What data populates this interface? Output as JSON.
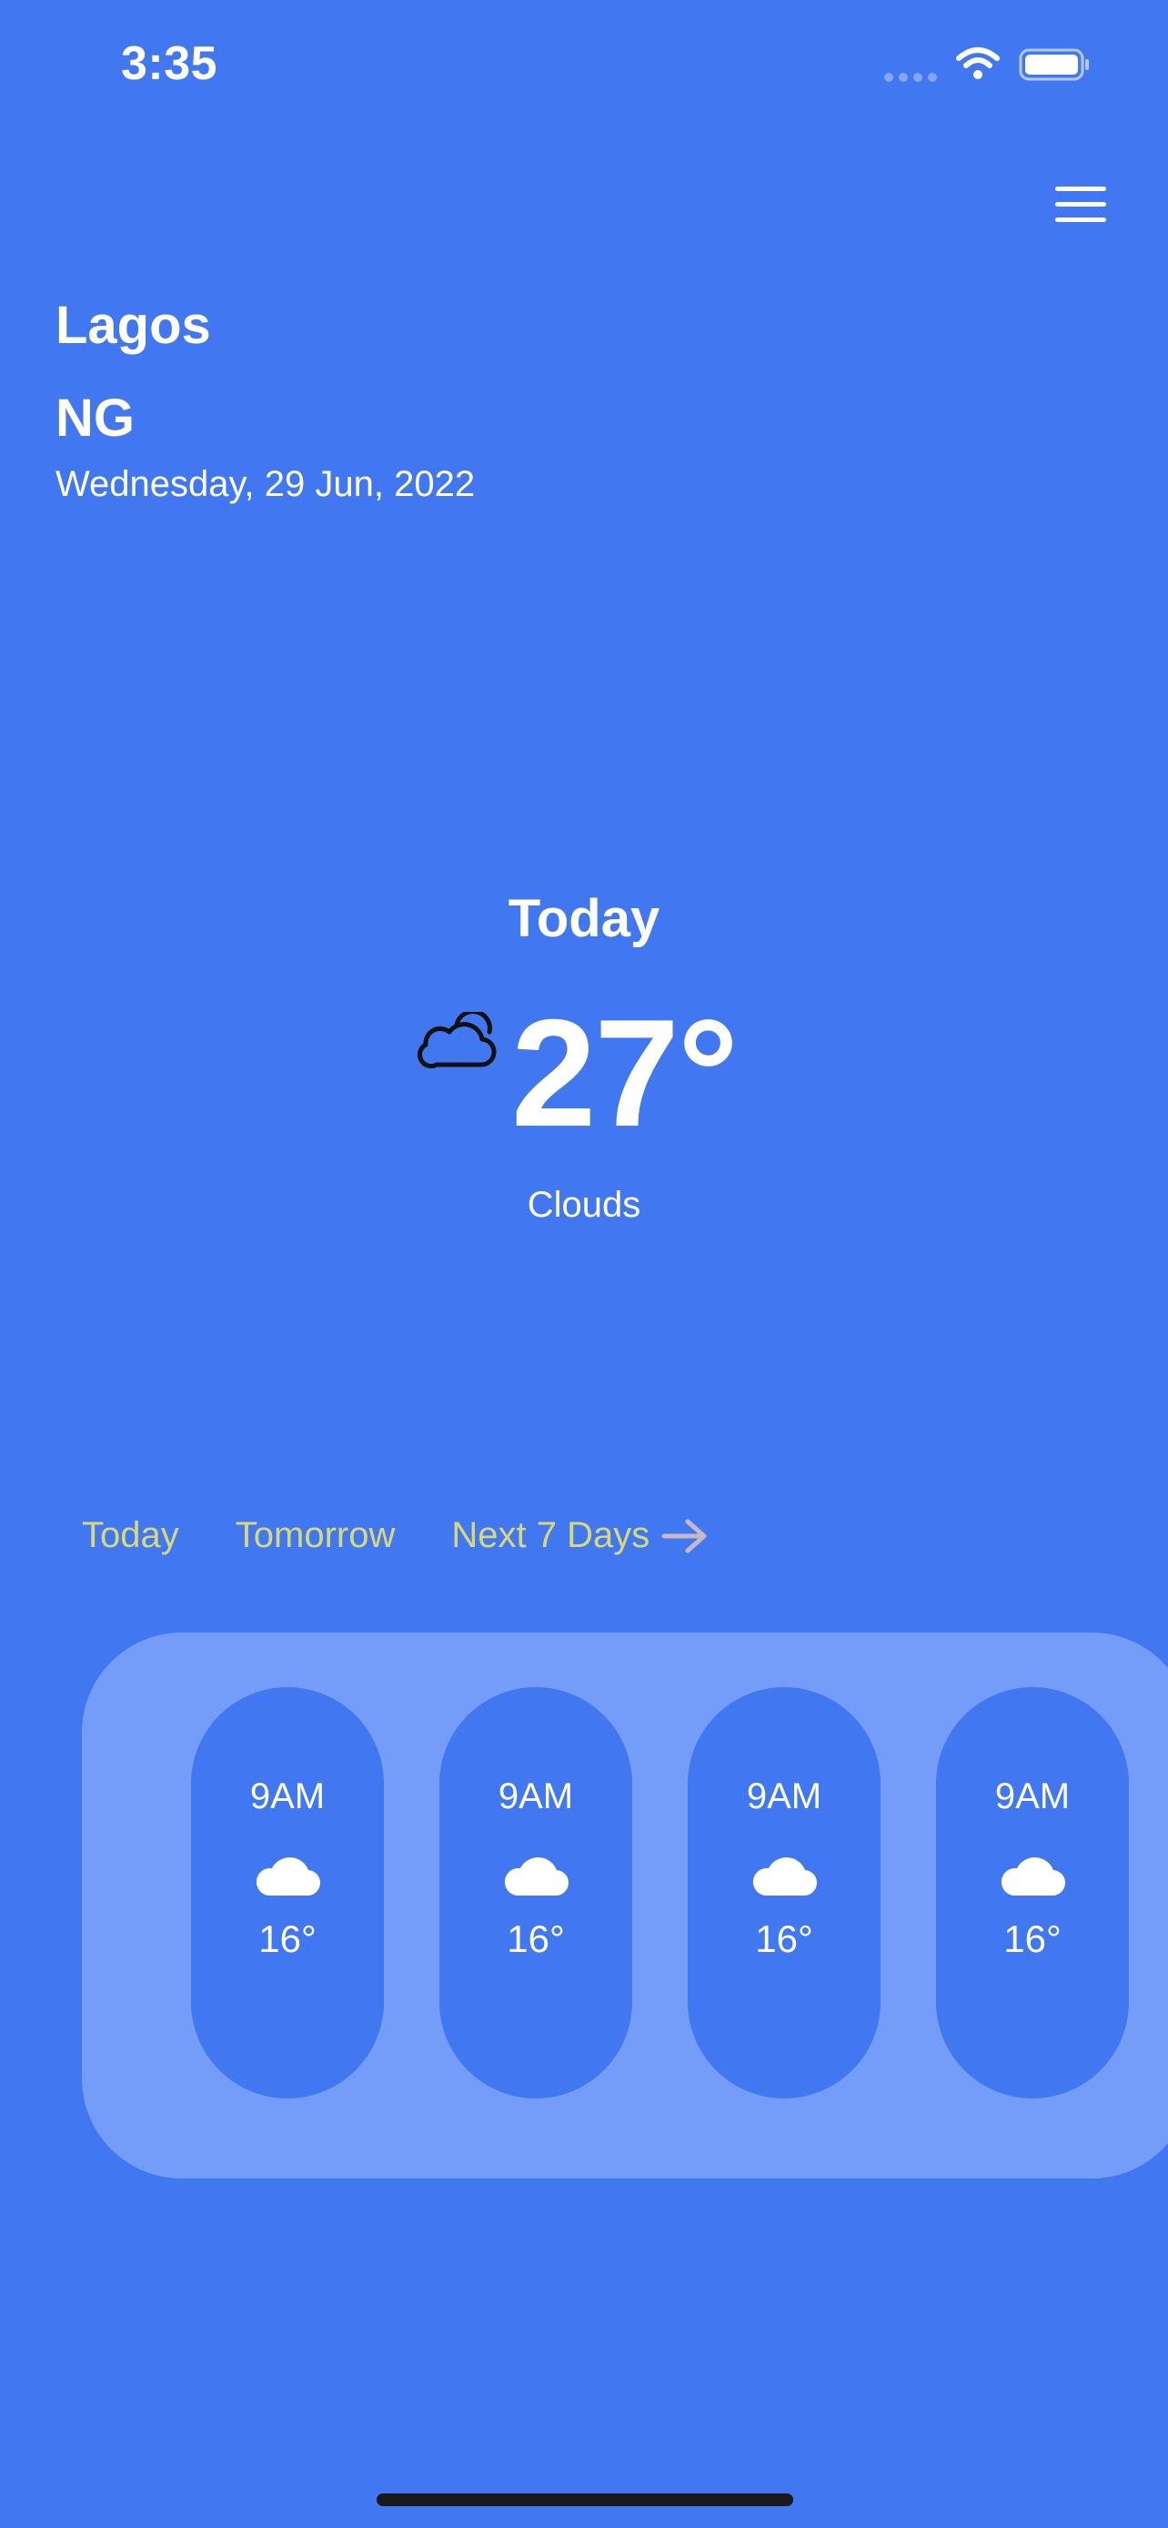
{
  "status_bar": {
    "time": "3:35"
  },
  "location": {
    "city": "Lagos",
    "country": "NG",
    "date": "Wednesday, 29 Jun, 2022"
  },
  "today": {
    "title": "Today",
    "temperature": "27°",
    "condition": "Clouds",
    "icon": "cloud-outline-icon"
  },
  "tabs": [
    "Today",
    "Tomorrow",
    "Next 7 Days"
  ],
  "hourly": [
    {
      "time": "9AM",
      "temp": "16°",
      "icon": "cloud-icon"
    },
    {
      "time": "9AM",
      "temp": "16°",
      "icon": "cloud-icon"
    },
    {
      "time": "9AM",
      "temp": "16°",
      "icon": "cloud-icon"
    },
    {
      "time": "9AM",
      "temp": "16°",
      "icon": "cloud-icon"
    }
  ],
  "colors": {
    "background": "#4178F1",
    "panel": "#749DFA",
    "tab_text": "#D9D878"
  }
}
